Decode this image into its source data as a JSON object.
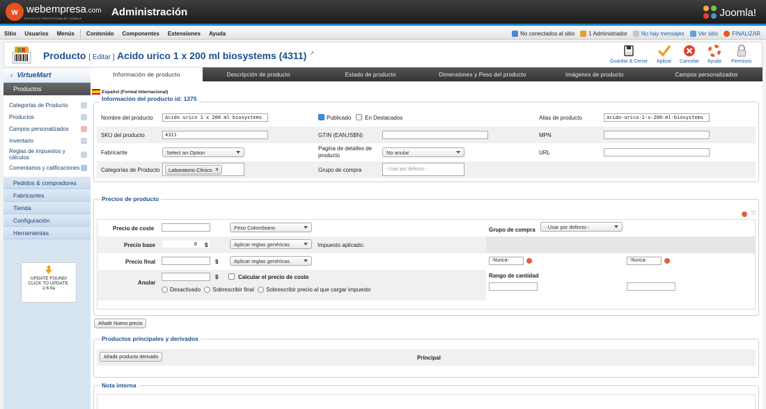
{
  "topbar": {
    "logo_mark": "w",
    "logo_name": "webempresa",
    "logo_suffix": ".com",
    "logo_sub": "SERVICIOS PROFESIONALES JOOMLA",
    "title": "Administración",
    "joomla": "Joomla!"
  },
  "menu": {
    "items": [
      "Sitio",
      "Usuarios",
      "Menús",
      "Contenido",
      "Componentes",
      "Extensiones",
      "Ayuda"
    ],
    "status": {
      "offline": "No conectados al sitio",
      "admins": "1 Administrador",
      "messages": "No hay mensajes",
      "view_site": "Ver sitio",
      "logout": "FINALIZAR"
    }
  },
  "header": {
    "title": "Producto",
    "edit": "[ Editar ]",
    "product_name": "Acido urico 1 x 200 ml biosystems (4311)",
    "toolbar": {
      "save_close": "Guardar & Cerrar",
      "apply": "Aplicar",
      "cancel": "Cancelar",
      "help": "Ayuda",
      "permissions": "Permisos"
    }
  },
  "sidebar": {
    "logo": "VirtueMart",
    "section": "Productos",
    "items": [
      "Categorías de Producto",
      "Productos",
      "Campos personalizados",
      "Inventario",
      "Reglas de impuestos y cálculos",
      "Comentarios y calificaciones"
    ],
    "categories": [
      "Pedidos & compradores",
      "Fabricantes",
      "Tienda",
      "Configuración",
      "Herramientas"
    ],
    "update": {
      "line1": "UPDATE FOUND!",
      "line2": "CLICK TO UPDATE.",
      "version": "2.6.0a"
    }
  },
  "tabs": [
    "Información de producto",
    "Descripción de producto",
    "Estado de producto",
    "Dimensiones y Peso del producto",
    "Imágenes de producto",
    "Campos personalizados"
  ],
  "language": "Español (Formal Internacional)",
  "info": {
    "legend": "Información del producto id: 1375",
    "name_label": "Nombre del producto",
    "name_value": "Acido urico 1 x 200 ml biosystems",
    "published_label": "Publicado",
    "featured_label": "En Destacados",
    "alias_label": "Alias de producto",
    "alias_value": "acido-urico-1-x-200-ml-biosystems",
    "sku_label": "SKU del producto",
    "sku_value": "4311",
    "gtin_label": "GTIN (EAN,ISBN)",
    "gtin_value": "",
    "mpn_label": "MPN",
    "mpn_value": "",
    "manufacturer_label": "Fabricante",
    "manufacturer_value": "Select an Option",
    "details_page_label_1": "Pagina de detalles de",
    "details_page_label_2": "producto",
    "details_page_value": "No anular",
    "url_label": "URL",
    "url_value": "",
    "category_label": "Categorías de Producto",
    "category_chip": "Laboratorio Clinico",
    "group_label": "Grupo de compra",
    "group_placeholder": "- Usar por defecto -"
  },
  "prices": {
    "legend": "Precios de producto",
    "cost_label": "Precio de coste",
    "cost_value": "",
    "currency": "Peso Colombiano",
    "group_label": "Grupo de compra",
    "group_value": "- Usar por defecto -",
    "base_label": "Precio base",
    "base_value": "0",
    "currency_symbol": "$",
    "rules_value": "Aplicar reglas genéricas",
    "tax_label": "Impuesto aplicado:",
    "final_label": "Precio final",
    "final_value": "",
    "rules_value_2": "Aplicar reglas genéricas",
    "never_1": "-Nunca-",
    "never_2": "-Nunca-",
    "override_label": "Anular",
    "override_value": "",
    "calc_cost_label": "Calcular el precio de coste",
    "radio_disabled": "Desactivado",
    "radio_overwrite_final": "Sobrescribir final",
    "radio_overwrite_tax": "Sobrescribir precio al que cargar impuesto",
    "quantity_range_label": "Rango de cantidad",
    "add_price_button": "Añadir Nuevo precio"
  },
  "derived": {
    "legend": "Productos principales y derivados",
    "add_button": "Añadir producto derivado",
    "principal_header": "Principal"
  },
  "note": {
    "legend": "Nota interna"
  }
}
